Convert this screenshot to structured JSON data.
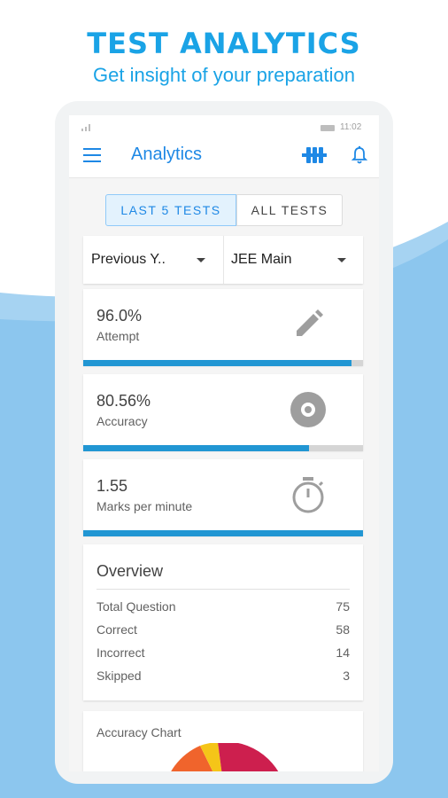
{
  "headline": "TEST ANALYTICS",
  "subline": "Get insight of your preparation",
  "status": {
    "time": "11:02"
  },
  "appbar": {
    "title": "Analytics",
    "menu_icon": "hamburger-menu-icon",
    "logo_icon": "brand-logo-icon",
    "bell_icon": "bell-icon"
  },
  "tabs": [
    {
      "label": "LAST 5 TESTS",
      "selected": true
    },
    {
      "label": "ALL TESTS",
      "selected": false
    }
  ],
  "filters": {
    "category": "Previous Y..",
    "exam": "JEE Main"
  },
  "stats": [
    {
      "value": "96.0%",
      "label": "Attempt",
      "progress": 0.96,
      "icon": "pencil-icon"
    },
    {
      "value": "80.56%",
      "label": "Accuracy",
      "progress": 0.8056,
      "icon": "target-disc-icon"
    },
    {
      "value": "1.55",
      "label": "Marks per minute",
      "progress": 1.0,
      "icon": "stopwatch-icon"
    }
  ],
  "overview": {
    "title": "Overview",
    "rows": [
      {
        "label": "Total Question",
        "value": "75"
      },
      {
        "label": "Correct",
        "value": "58"
      },
      {
        "label": "Incorrect",
        "value": "14"
      },
      {
        "label": "Skipped",
        "value": "3"
      }
    ]
  },
  "accuracy_chart": {
    "title": "Accuracy Chart",
    "colors": {
      "orange": "#f0642c",
      "yellow": "#f5c518",
      "crimson": "#cd1f4e"
    }
  },
  "colors": {
    "accent": "#1aa3e6",
    "primary": "#1e88e5",
    "progress": "#2196d3"
  }
}
